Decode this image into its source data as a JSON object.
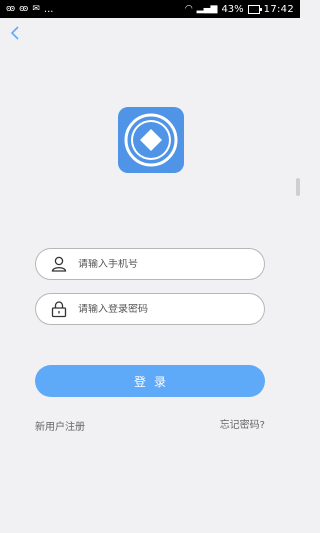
{
  "status_bar": {
    "left_icons": [
      "weibo-icon",
      "weibo-icon",
      "chat-icon",
      "more-dots-icon"
    ],
    "left_text": "...",
    "battery": "43%",
    "time": "17:42"
  },
  "header": {
    "back_icon": "chevron-left-icon"
  },
  "logo": {
    "icon": "app-logo-diamond-icon",
    "color": "#4f94e6"
  },
  "form": {
    "phone": {
      "placeholder": "请输入手机号",
      "value": "",
      "icon": "user-icon"
    },
    "password": {
      "placeholder": "请输入登录密码",
      "value": "",
      "icon": "lock-icon"
    }
  },
  "login_button": {
    "label": "登录",
    "color": "#5ea9f8"
  },
  "links": {
    "register": "新用户注册",
    "forgot_password": "忘记密码?"
  }
}
